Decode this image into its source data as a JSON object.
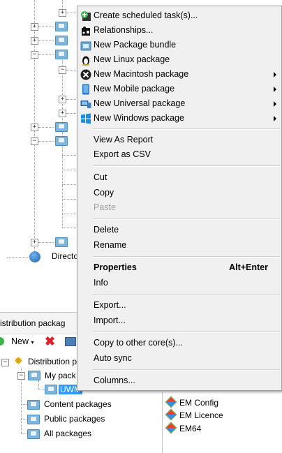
{
  "background_tree": {
    "directory_label": "Directo"
  },
  "lower_panel": {
    "header": "istribution packag",
    "toolbar": {
      "new_label": "New"
    },
    "tree": {
      "root": "Distribution p",
      "my_packages": "My pack",
      "selected": "UWM",
      "content": "Content packages",
      "public": "Public packages",
      "all": "All packages"
    }
  },
  "right_list": {
    "items": [
      "EM Config",
      "EM Licence",
      "EM64"
    ]
  },
  "context_menu": {
    "items": [
      {
        "label": "Create scheduled task(s)...",
        "icon": "scheduled-task-icon"
      },
      {
        "label": "Relationships...",
        "icon": "relationships-icon"
      },
      {
        "label": "New Package bundle",
        "icon": "package-bundle-icon"
      },
      {
        "label": "New Linux package",
        "icon": "linux-icon"
      },
      {
        "label": "New Macintosh package",
        "icon": "macos-icon",
        "submenu": true
      },
      {
        "label": "New Mobile package",
        "icon": "mobile-icon",
        "submenu": true
      },
      {
        "label": "New Universal package",
        "icon": "universal-icon",
        "submenu": true
      },
      {
        "label": "New Windows package",
        "icon": "windows-icon",
        "submenu": true
      },
      {
        "label": "View As Report"
      },
      {
        "label": "Export as CSV"
      },
      {
        "label": "Cut"
      },
      {
        "label": "Copy"
      },
      {
        "label": "Paste",
        "disabled": true
      },
      {
        "label": "Delete"
      },
      {
        "label": "Rename"
      },
      {
        "label": "Properties",
        "bold": true,
        "shortcut": "Alt+Enter"
      },
      {
        "label": "Info"
      },
      {
        "label": "Export..."
      },
      {
        "label": "Import..."
      },
      {
        "label": "Copy to other core(s)..."
      },
      {
        "label": "Auto sync"
      },
      {
        "label": "Columns..."
      }
    ]
  }
}
